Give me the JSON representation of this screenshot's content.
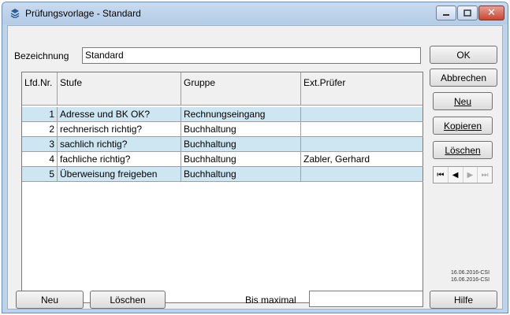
{
  "window": {
    "title": "Prüfungsvorlage - Standard",
    "close_glyph": "✕"
  },
  "form": {
    "bezeichnung_label": "Bezeichnung",
    "bezeichnung_value": "Standard",
    "bis_maximal_label": "Bis maximal",
    "bis_maximal_value": ""
  },
  "grid": {
    "columns": [
      "Lfd.Nr.",
      "Stufe",
      "Gruppe",
      "Ext.Prüfer"
    ],
    "rows": [
      {
        "nr": "1",
        "stufe": "Adresse und BK OK?",
        "gruppe": "Rechnungseingang",
        "pruefer": ""
      },
      {
        "nr": "2",
        "stufe": "rechnerisch richtig?",
        "gruppe": "Buchhaltung",
        "pruefer": ""
      },
      {
        "nr": "3",
        "stufe": "sachlich richtig?",
        "gruppe": "Buchhaltung",
        "pruefer": ""
      },
      {
        "nr": "4",
        "stufe": "fachliche richtig?",
        "gruppe": "Buchhaltung",
        "pruefer": "Zabler, Gerhard"
      },
      {
        "nr": "5",
        "stufe": "Überweisung freigeben",
        "gruppe": "Buchhaltung",
        "pruefer": ""
      }
    ]
  },
  "buttons": {
    "ok": "OK",
    "abbrechen": "Abbrechen",
    "neu_right": "Neu",
    "kopieren": "Kopieren",
    "loeschen_right": "Löschen",
    "neu_bottom": "Neu",
    "loeschen_bottom": "Löschen",
    "hilfe": "Hilfe"
  },
  "navigator": {
    "first": "⏮",
    "prev": "◀",
    "next": "▶",
    "last": "⏭"
  },
  "stamps": [
    "16.06.2016-CSI",
    "16.06.2016-CSI"
  ],
  "colors": {
    "row_highlight": "#cde6f2",
    "title_bar": "#bcd3ea",
    "close_button": "#c9452f"
  }
}
